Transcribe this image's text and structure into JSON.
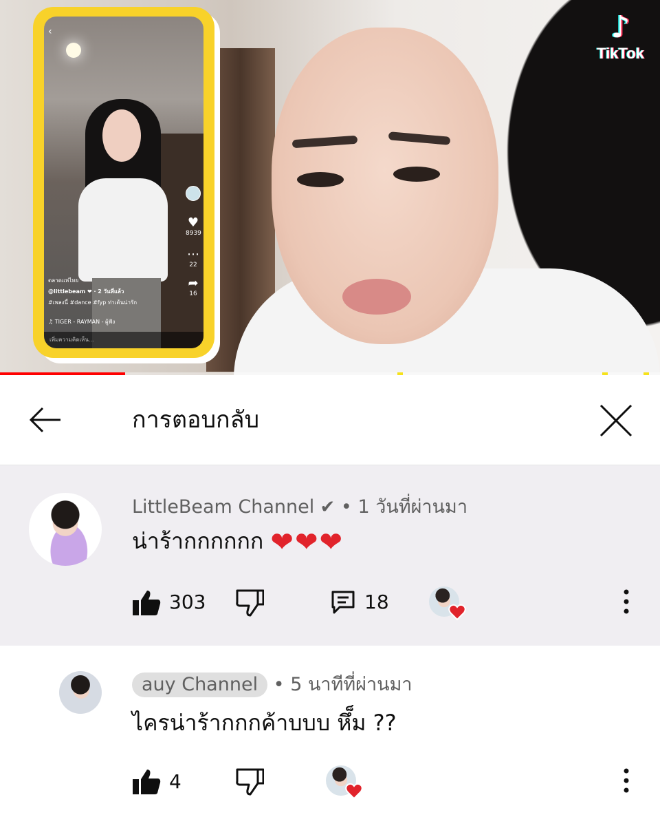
{
  "video": {
    "watermark": "TikTok",
    "watermark_icon": "tiktok-note-icon",
    "progress": 0.19,
    "inset": {
      "caption_user": "@littlebeam",
      "caption_lines": [
        "ตลาดแห่ไทย",
        "@littlebeam ❤ · 2 วันที่แล้ว",
        "#เพลงนี้ #dance #fyp ท่าเต้นน่ารัก",
        "♫ TIGER - RAYMAN - ผู้ฟัง"
      ],
      "like_count": "8939",
      "comment_count": "22",
      "share_count": "16",
      "comment_placeholder": "เพิ่มความคิดเห็น..."
    }
  },
  "header": {
    "title": "การตอบกลับ",
    "back_icon": "back-arrow-icon",
    "close_icon": "close-icon"
  },
  "parent_comment": {
    "author": "LittleBeam Channel",
    "verified": true,
    "time": "1 วันที่ผ่านมา",
    "text": "น่าร้ากกกกกก",
    "hearts": "❤❤❤",
    "likes": "303",
    "replies": "18"
  },
  "reply": {
    "author": "auy Channel",
    "time": "5 นาทีที่ผ่านมา",
    "text": "ไครน่าร้ากกกค้าบบบ หึ็ม ??",
    "likes": "4"
  },
  "colors": {
    "accent_red": "#ff0000",
    "heart_red": "#e1232b",
    "inset_frame_yellow": "#f8d22a",
    "parent_bg": "#f0eef2",
    "secondary_text": "#606060"
  }
}
